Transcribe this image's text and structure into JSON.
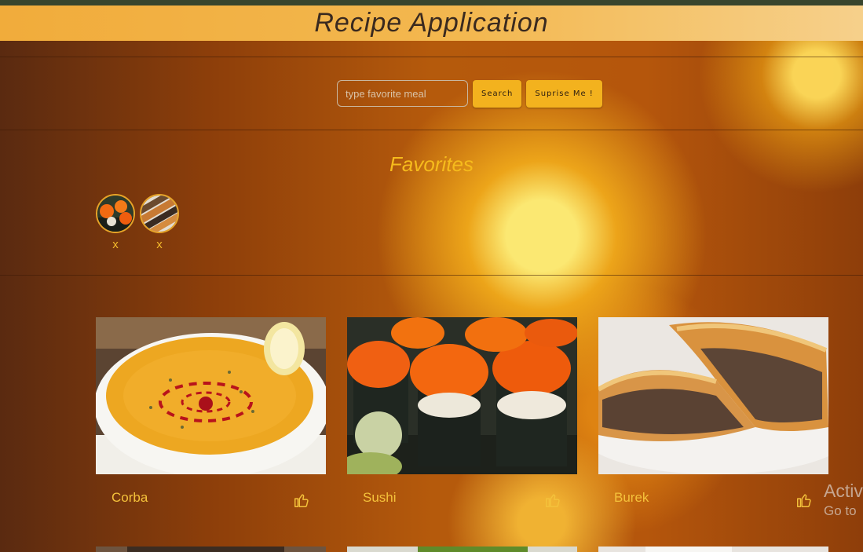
{
  "app": {
    "title": "Recipe Application"
  },
  "search": {
    "placeholder": "type favorite meal",
    "value": "",
    "search_label": "Search",
    "surprise_label": "Suprise Me !"
  },
  "favorites": {
    "heading": "Favorites",
    "items": [
      {
        "meal": "Sushi",
        "remove_label": "x"
      },
      {
        "meal": "Burek",
        "remove_label": "x"
      }
    ]
  },
  "meals": [
    {
      "name": "Corba",
      "like_icon": "thumbs-up-icon"
    },
    {
      "name": "Sushi",
      "like_icon": "thumbs-up-icon"
    },
    {
      "name": "Burek",
      "like_icon": "thumbs-up-icon"
    }
  ],
  "colors": {
    "header_bg": "#f1ac3b",
    "accent": "#f3b21e",
    "meal_name": "#f4c23b",
    "favorites_heading": "#f6bb1c"
  },
  "os_overlay": {
    "line1": "Activ",
    "line2": "Go to"
  }
}
